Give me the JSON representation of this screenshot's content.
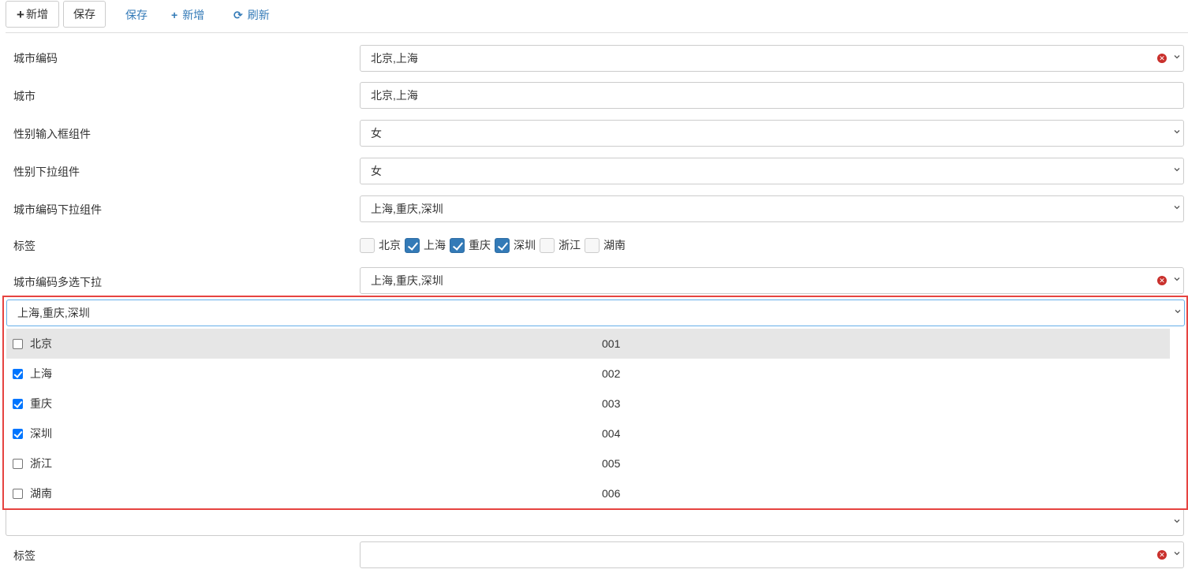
{
  "toolbar": {
    "add_button": "新增",
    "save_button": "保存",
    "save_link": "保存",
    "add_link": "新增",
    "refresh_link": "刷新"
  },
  "form": {
    "city_code": {
      "label": "城市编码",
      "value": "北京,上海"
    },
    "city": {
      "label": "城市",
      "value": "北京,上海"
    },
    "gender_input": {
      "label": "性别输入框组件",
      "value": "女"
    },
    "gender_select": {
      "label": "性别下拉组件",
      "value": "女"
    },
    "city_code_select": {
      "label": "城市编码下拉组件",
      "value": "上海,重庆,深圳"
    },
    "tags": {
      "label": "标签",
      "options": [
        {
          "label": "北京",
          "checked": false
        },
        {
          "label": "上海",
          "checked": true
        },
        {
          "label": "重庆",
          "checked": true
        },
        {
          "label": "深圳",
          "checked": true
        },
        {
          "label": "浙江",
          "checked": false
        },
        {
          "label": "湖南",
          "checked": false
        }
      ]
    },
    "city_code_multi": {
      "label": "城市编码多选下拉",
      "value": "上海,重庆,深圳"
    },
    "tags2": {
      "label": "标签",
      "value": ""
    }
  },
  "dropdown": {
    "value": "上海,重庆,深圳",
    "items": [
      {
        "name": "北京",
        "code": "001",
        "checked": false
      },
      {
        "name": "上海",
        "code": "002",
        "checked": true
      },
      {
        "name": "重庆",
        "code": "003",
        "checked": true
      },
      {
        "name": "深圳",
        "code": "004",
        "checked": true
      },
      {
        "name": "浙江",
        "code": "005",
        "checked": false
      },
      {
        "name": "湖南",
        "code": "006",
        "checked": false
      }
    ]
  },
  "colors": {
    "highlight_border": "#e64340",
    "link": "#337ab7",
    "clear_icon": "#c9302c"
  }
}
